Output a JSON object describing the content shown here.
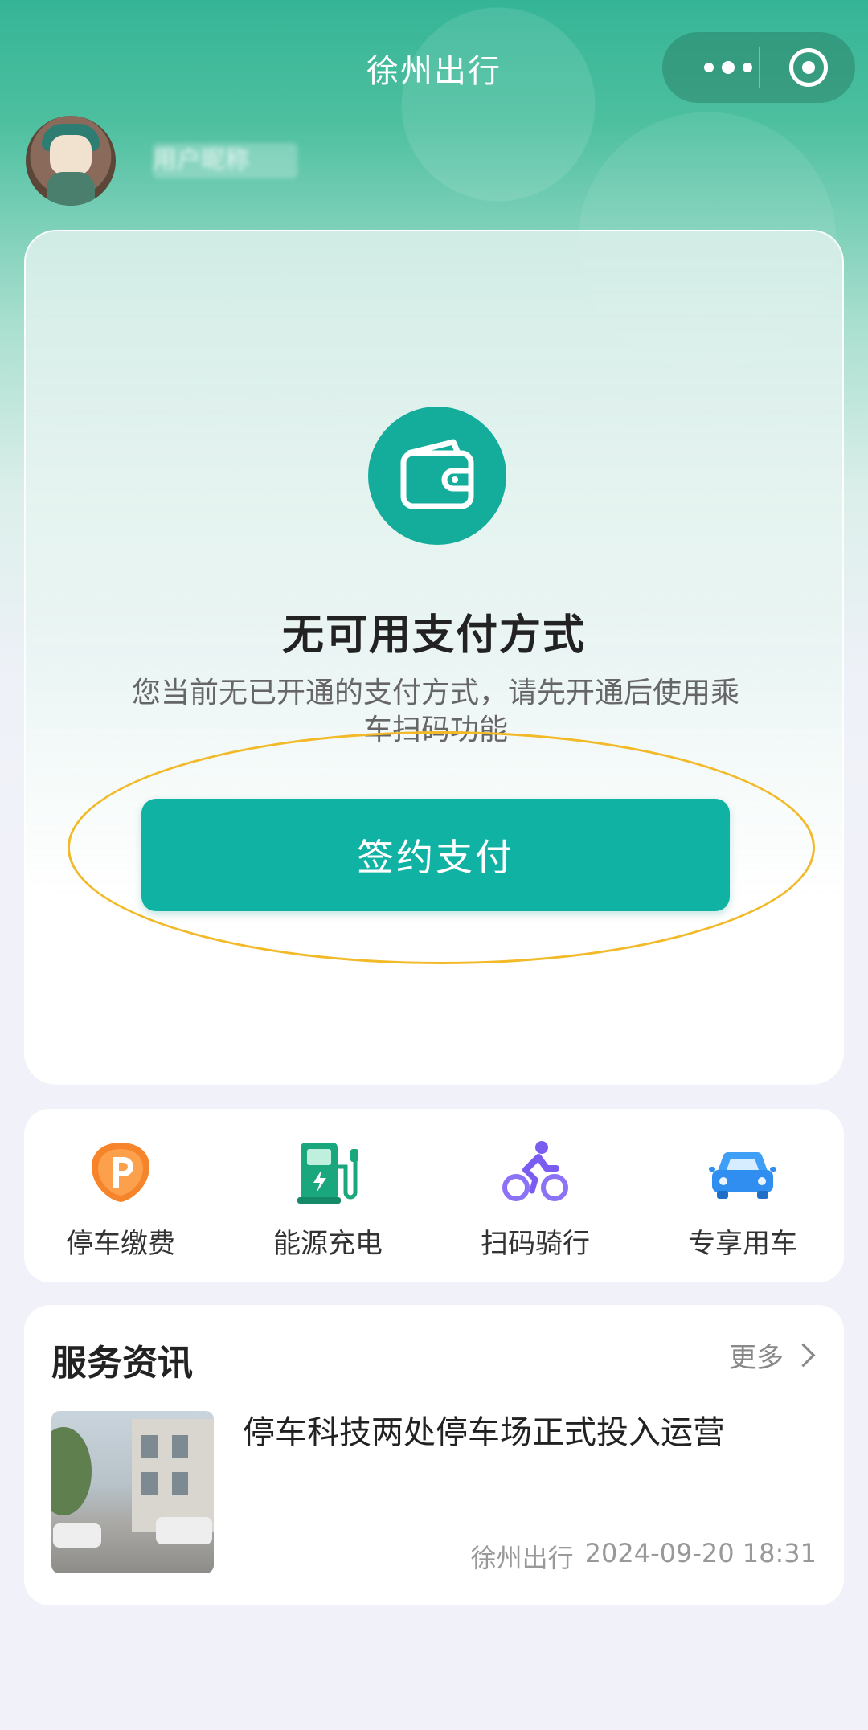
{
  "header": {
    "title": "徐州出行"
  },
  "user": {
    "name": "用户昵称"
  },
  "payment": {
    "title": "无可用支付方式",
    "description": "您当前无已开通的支付方式，请先开通后使用乘车扫码功能",
    "sign_button": "签约支付"
  },
  "services": [
    {
      "label": "停车缴费",
      "icon": "parking-icon"
    },
    {
      "label": "能源充电",
      "icon": "charging-icon"
    },
    {
      "label": "扫码骑行",
      "icon": "bike-icon"
    },
    {
      "label": "专享用车",
      "icon": "car-icon"
    }
  ],
  "news": {
    "section_title": "服务资讯",
    "more_label": "更多",
    "items": [
      {
        "headline": "停车科技两处停车场正式投入运营",
        "source": "徐州出行",
        "date": "2024-09-20 18:31"
      }
    ]
  },
  "colors": {
    "brand_teal": "#10b3a3",
    "highlight": "#f2b928"
  }
}
